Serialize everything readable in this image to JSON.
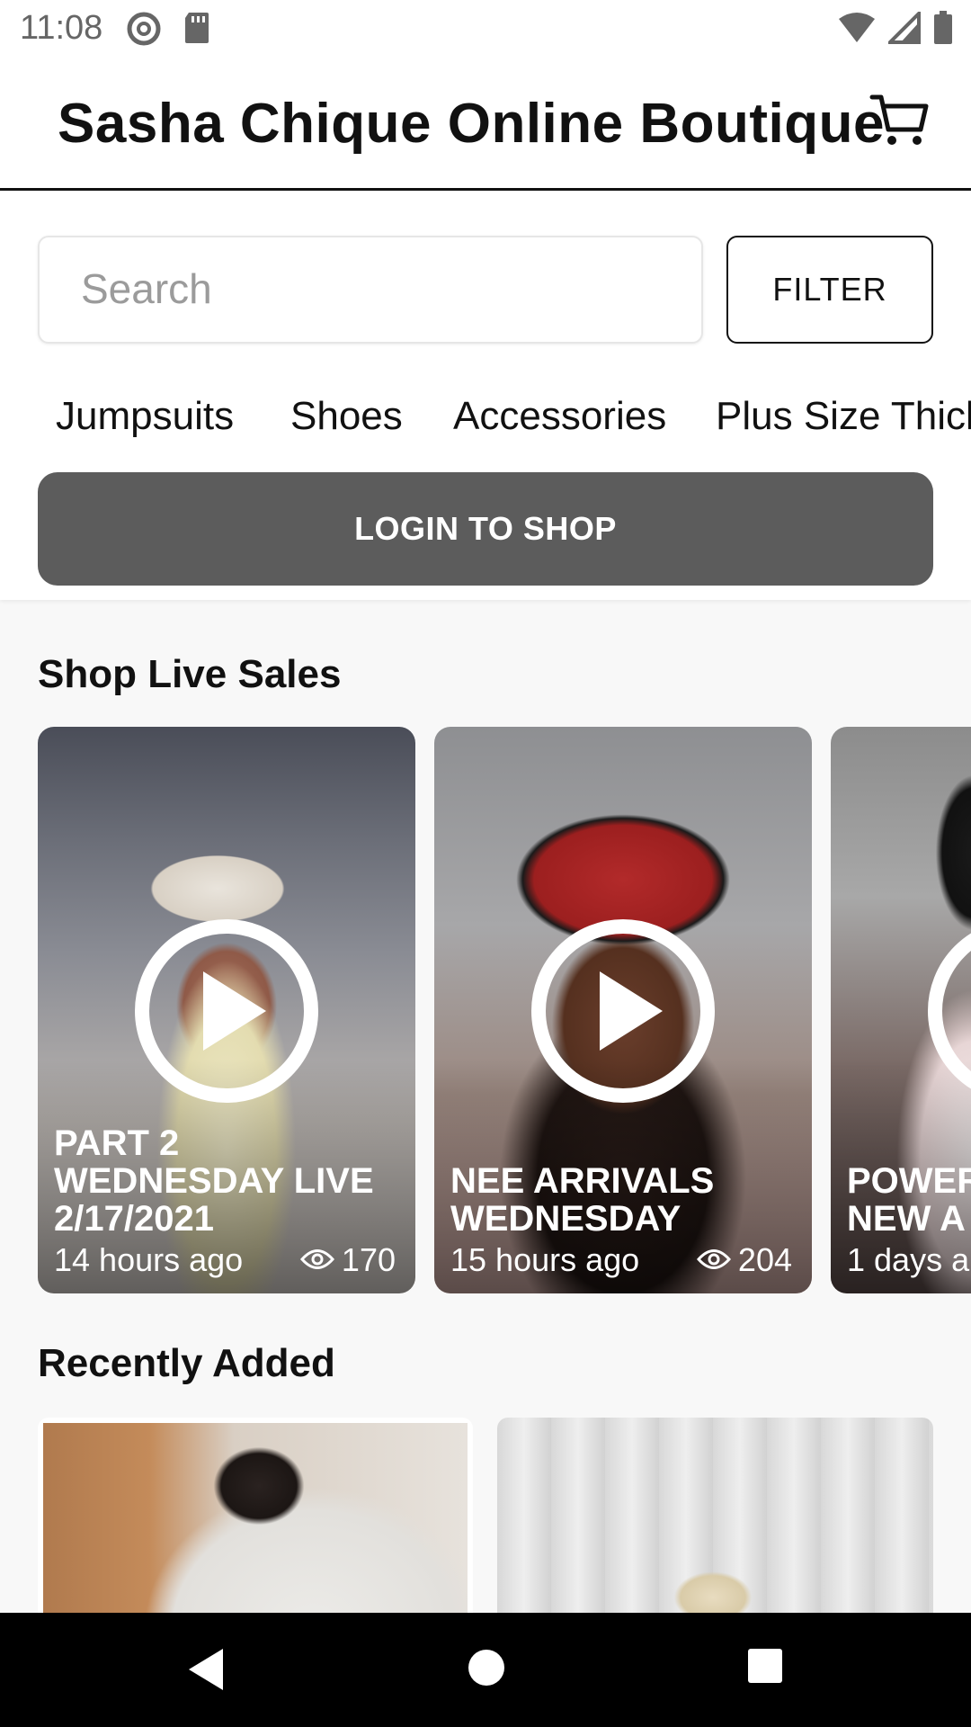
{
  "status_bar": {
    "time": "11:08",
    "icons": [
      "at-sign-icon",
      "sd-card-icon",
      "wifi-icon",
      "signal-icon",
      "battery-icon"
    ]
  },
  "header": {
    "title": "Sasha Chique Online Boutique",
    "cart_icon": "cart-icon"
  },
  "search": {
    "placeholder": "Search",
    "value": ""
  },
  "filter": {
    "label": "FILTER"
  },
  "categories": [
    "Jumpsuits",
    "Shoes",
    "Accessories",
    "Plus Size Thick-"
  ],
  "login_button": {
    "label": "LOGIN TO SHOP"
  },
  "live_sales": {
    "title": "Shop Live Sales",
    "cards": [
      {
        "title": "PART 2\nWEDNESDAY LIVE\n2/17/2021",
        "time": "14 hours ago",
        "views": "170"
      },
      {
        "title": "NEE ARRIVALS\nWEDNESDAY",
        "time": "15 hours ago",
        "views": "204"
      },
      {
        "title": "POWER\nNEW A",
        "time": "1 days a",
        "views": ""
      }
    ]
  },
  "recently_added": {
    "title": "Recently Added"
  },
  "colors": {
    "login_button_bg": "#5c5c5c",
    "header_border": "#111111",
    "page_bg": "#f8f8f8"
  }
}
